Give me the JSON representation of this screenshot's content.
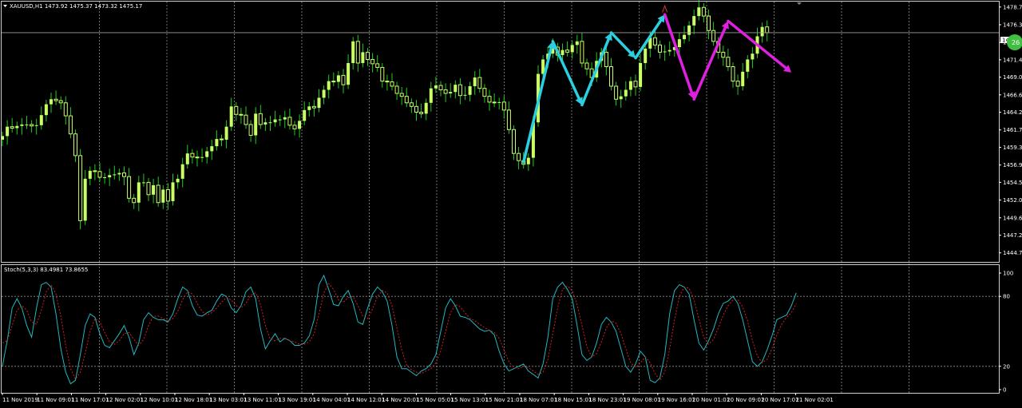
{
  "symbol_header": "XAUUSD,H1  1473.92 1475.37 1473.32 1475.17",
  "indicator_header": "Stoch(5,3,3) 83.4981 73.8655",
  "current_price_label": "1475",
  "current_price_bubble": "26",
  "colors": {
    "background": "#000000",
    "grid": "#c8c8c8",
    "candle": "#ccff66",
    "wick": "#1fcc1f",
    "arrow_cyan": "#2ad0e0",
    "arrow_magenta": "#e020e0",
    "stoch_main": "#22b8c0",
    "stoch_signal": "#d02020",
    "price_line": "#a0a0a0",
    "bubble": "#40c040"
  },
  "chart_data": [
    {
      "type": "candlestick",
      "title": "XAUUSD,H1",
      "ylim": [
        1443.5,
        1479.5
      ],
      "y_ticks": [
        "1478.75",
        "1476.30",
        "1473.85",
        "1471.45",
        "1469.05",
        "1466.60",
        "1464.20",
        "1461.75",
        "1459.35",
        "1456.90",
        "1454.50",
        "1452.05",
        "1449.60",
        "1447.20",
        "1444.75"
      ],
      "x_ticks": [
        "11 Nov 2019",
        "11 Nov 09:01",
        "11 Nov 17:01",
        "12 Nov 02:01",
        "12 Nov 10:01",
        "12 Nov 18:01",
        "13 Nov 03:01",
        "13 Nov 11:01",
        "13 Nov 19:01",
        "14 Nov 04:01",
        "14 Nov 12:01",
        "14 Nov 20:01",
        "15 Nov 05:01",
        "15 Nov 13:01",
        "15 Nov 21:01",
        "18 Nov 07:01",
        "18 Nov 15:01",
        "18 Nov 23:01",
        "19 Nov 08:01",
        "19 Nov 16:01",
        "20 Nov 01:01",
        "20 Nov 09:01",
        "20 Nov 17:01",
        "21 Nov 02:01"
      ],
      "close": [
        1460.9,
        1462.2,
        1462.0,
        1462.3,
        1462.5,
        1462.5,
        1462.3,
        1462.4,
        1463.8,
        1465.3,
        1466.0,
        1465.8,
        1465.5,
        1463.7,
        1461.2,
        1458.2,
        1449.2,
        1455.0,
        1456.1,
        1456.0,
        1455.2,
        1455.2,
        1455.5,
        1455.6,
        1455.8,
        1455.3,
        1452.3,
        1451.7,
        1454.5,
        1454.5,
        1452.8,
        1454.1,
        1451.7,
        1453.5,
        1451.9,
        1454.5,
        1455.0,
        1457.0,
        1458.5,
        1458.0,
        1457.9,
        1458.0,
        1458.8,
        1459.5,
        1460.5,
        1460.4,
        1462.2,
        1465.0,
        1463.9,
        1463.8,
        1462.5,
        1461.0,
        1464.0,
        1462.5,
        1462.8,
        1462.8,
        1463.2,
        1463.2,
        1463.5,
        1462.4,
        1461.9,
        1463.0,
        1464.5,
        1465.0,
        1464.8,
        1466.2,
        1467.3,
        1468.5,
        1468.4,
        1469.3,
        1468.0,
        1471.0,
        1474.0,
        1471.0,
        1472.5,
        1471.5,
        1470.9,
        1470.4,
        1468.5,
        1468.4,
        1467.8,
        1466.8,
        1466.4,
        1465.5,
        1465.0,
        1464.2,
        1464.0,
        1465.5,
        1467.5,
        1467.9,
        1467.3,
        1466.8,
        1467.0,
        1468.0,
        1466.5,
        1466.6,
        1467.8,
        1469.0,
        1467.5,
        1466.4,
        1465.6,
        1465.5,
        1465.6,
        1464.5,
        1461.8,
        1458.5,
        1457.5,
        1457.0,
        1457.9,
        1462.8,
        1469.5,
        1471.5,
        1472.3,
        1473.2,
        1472.1,
        1472.8,
        1472.5,
        1473.5,
        1474.0,
        1471.0,
        1470.2,
        1469.0,
        1471.3,
        1472.5,
        1470.5,
        1467.8,
        1466.0,
        1466.4,
        1467.3,
        1468.5,
        1467.7,
        1471.0,
        1473.0,
        1474.5,
        1473.5,
        1472.5,
        1472.6,
        1472.8,
        1473.2,
        1474.3,
        1474.9,
        1476.2,
        1477.5,
        1478.7,
        1477.5,
        1475.5,
        1474.0,
        1472.5,
        1471.8,
        1470.5,
        1468.5,
        1467.8,
        1469.8,
        1471.5,
        1472.3,
        1474.7,
        1476.0,
        1475.2
      ],
      "annotation_cyan_zigzag": [
        [
          107,
          1457.3
        ],
        [
          113,
          1474.0
        ],
        [
          119,
          1465.2
        ],
        [
          125,
          1475.2
        ],
        [
          130,
          1471.7
        ],
        [
          136,
          1477.7
        ]
      ],
      "annotation_magenta_zigzag": [
        [
          136,
          1477.7
        ],
        [
          142,
          1466.0
        ],
        [
          149,
          1476.8
        ],
        [
          162,
          1469.7
        ]
      ]
    },
    {
      "type": "line",
      "title": "Stoch(5,3,3) 83.4981 73.8655",
      "ylim": [
        0,
        100
      ],
      "y_ticks": [
        "100",
        "80",
        "20",
        "0"
      ],
      "levels": [
        80,
        20
      ],
      "series": [
        {
          "name": "Main",
          "values": [
            20,
            42,
            70,
            78,
            70,
            55,
            45,
            70,
            90,
            92,
            88,
            65,
            35,
            15,
            5,
            8,
            30,
            55,
            65,
            62,
            48,
            38,
            36,
            42,
            48,
            55,
            45,
            30,
            40,
            60,
            66,
            62,
            60,
            60,
            58,
            65,
            78,
            88,
            85,
            72,
            64,
            63,
            66,
            68,
            76,
            82,
            80,
            70,
            66,
            72,
            84,
            88,
            78,
            52,
            35,
            42,
            48,
            41,
            44,
            42,
            38,
            38,
            40,
            46,
            60,
            90,
            98,
            86,
            73,
            72,
            80,
            85,
            74,
            58,
            56,
            70,
            82,
            88,
            84,
            76,
            55,
            28,
            18,
            18,
            15,
            12,
            16,
            18,
            22,
            30,
            50,
            70,
            78,
            72,
            63,
            62,
            60,
            56,
            52,
            50,
            51,
            47,
            33,
            22,
            16,
            18,
            20,
            22,
            16,
            13,
            10,
            22,
            45,
            78,
            88,
            92,
            86,
            78,
            55,
            30,
            25,
            28,
            40,
            56,
            62,
            58,
            50,
            35,
            20,
            15,
            22,
            33,
            28,
            8,
            6,
            10,
            30,
            65,
            85,
            90,
            88,
            82,
            60,
            40,
            34,
            42,
            52,
            65,
            74,
            76,
            80,
            74,
            60,
            42,
            24,
            20,
            24,
            34,
            46,
            60,
            62,
            64,
            72,
            83
          ]
        },
        {
          "name": "Signal",
          "values": [
            40,
            42,
            55,
            68,
            72,
            68,
            58,
            56,
            68,
            84,
            90,
            82,
            63,
            38,
            18,
            9,
            15,
            31,
            50,
            61,
            58,
            49,
            41,
            39,
            42,
            48,
            49,
            43,
            38,
            43,
            55,
            63,
            63,
            61,
            59,
            61,
            67,
            77,
            84,
            82,
            74,
            67,
            64,
            66,
            70,
            75,
            79,
            77,
            72,
            70,
            74,
            81,
            83,
            73,
            55,
            43,
            42,
            44,
            44,
            42,
            41,
            39,
            39,
            41,
            48,
            65,
            83,
            91,
            86,
            77,
            75,
            79,
            80,
            72,
            63,
            61,
            69,
            80,
            85,
            83,
            72,
            53,
            34,
            21,
            17,
            15,
            14,
            16,
            18,
            23,
            33,
            50,
            66,
            73,
            71,
            66,
            61,
            59,
            56,
            53,
            51,
            49,
            44,
            34,
            24,
            19,
            18,
            20,
            19,
            16,
            13,
            15,
            26,
            48,
            70,
            86,
            89,
            85,
            73,
            55,
            37,
            28,
            31,
            41,
            53,
            59,
            57,
            48,
            35,
            23,
            19,
            23,
            28,
            23,
            14,
            8,
            15,
            35,
            60,
            80,
            88,
            87,
            77,
            61,
            45,
            39,
            43,
            53,
            64,
            72,
            77,
            77,
            71,
            59,
            42,
            29,
            23,
            26,
            35,
            47,
            56,
            62,
            66,
            74
          ]
        }
      ]
    }
  ]
}
